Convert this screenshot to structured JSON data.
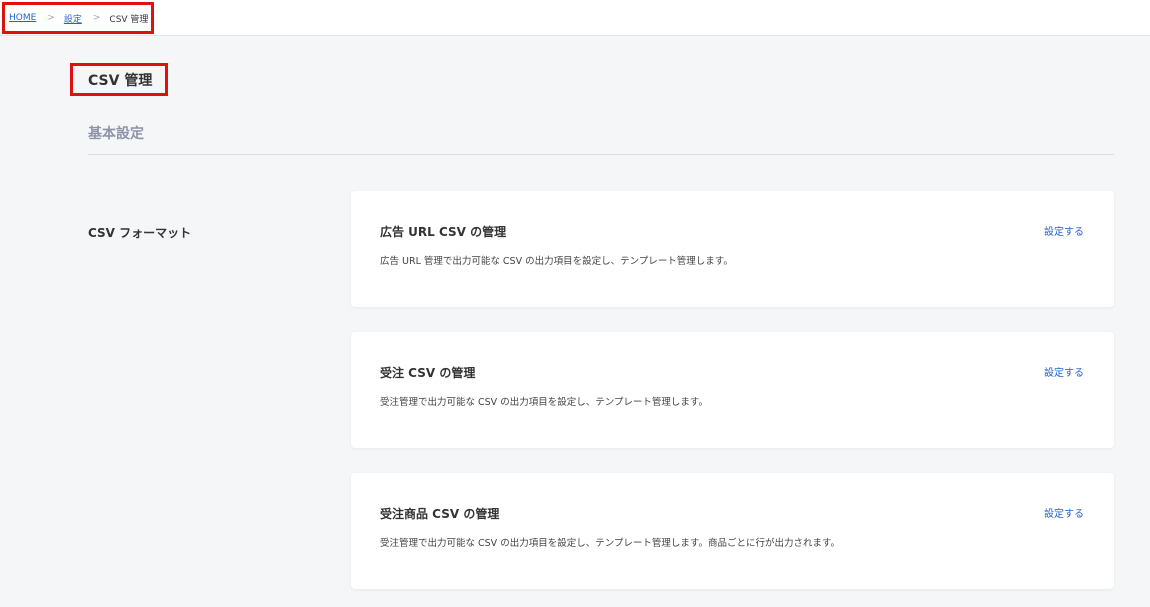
{
  "breadcrumb": {
    "home": "HOME",
    "settings": "設定",
    "current": "CSV 管理",
    "separator": ">"
  },
  "page": {
    "title": "CSV 管理",
    "section_title": "基本設定",
    "row_label": "CSV フォーマット"
  },
  "cards": [
    {
      "title": "広告 URL CSV の管理",
      "description": "広告 URL 管理で出力可能な CSV の出力項目を設定し、テンプレート管理します。",
      "link": "設定する"
    },
    {
      "title": "受注 CSV の管理",
      "description": "受注管理で出力可能な CSV の出力項目を設定し、テンプレート管理します。",
      "link": "設定する"
    },
    {
      "title": "受注商品 CSV の管理",
      "description": "受注管理で出力可能な CSV の出力項目を設定し、テンプレート管理します。商品ごとに行が出力されます。",
      "link": "設定する"
    }
  ],
  "colors": {
    "link": "#2563c9",
    "highlight_border": "#e01010",
    "section_title": "#8e93a8"
  }
}
